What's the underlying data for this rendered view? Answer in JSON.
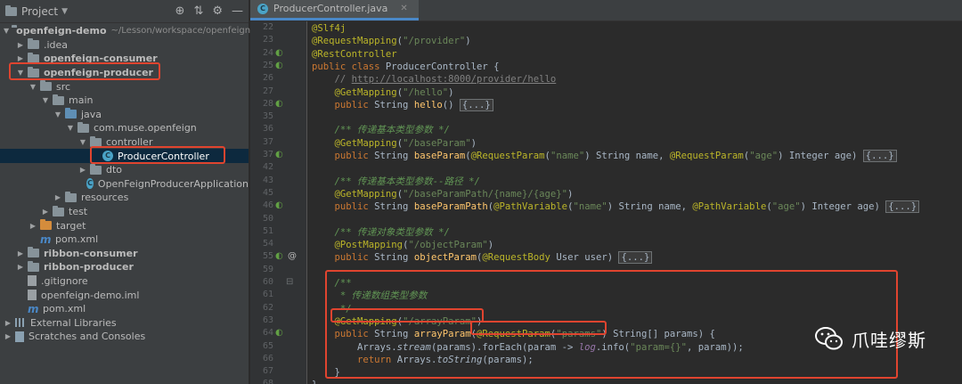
{
  "project_panel": {
    "title": "Project",
    "tree": [
      {
        "label": "openfeign-demo",
        "path": "~/Lesson/workspace/openfeign-d",
        "bold": true,
        "indent": 0,
        "arrow": "down",
        "icon": "folder"
      },
      {
        "label": ".idea",
        "indent": 1,
        "arrow": "right",
        "icon": "folder"
      },
      {
        "label": "openfeign-consumer",
        "bold": true,
        "indent": 1,
        "arrow": "right",
        "icon": "folder"
      },
      {
        "label": "openfeign-producer",
        "bold": true,
        "indent": 1,
        "arrow": "down",
        "icon": "folder"
      },
      {
        "label": "src",
        "indent": 2,
        "arrow": "down",
        "icon": "folder"
      },
      {
        "label": "main",
        "indent": 3,
        "arrow": "down",
        "icon": "folder"
      },
      {
        "label": "java",
        "indent": 4,
        "arrow": "down",
        "icon": "folder-blue"
      },
      {
        "label": "com.muse.openfeign",
        "indent": 5,
        "arrow": "down",
        "icon": "package"
      },
      {
        "label": "controller",
        "indent": 6,
        "arrow": "down",
        "icon": "package"
      },
      {
        "label": "ProducerController",
        "indent": 7,
        "arrow": "",
        "icon": "class",
        "selected": true
      },
      {
        "label": "dto",
        "indent": 6,
        "arrow": "right",
        "icon": "package"
      },
      {
        "label": "OpenFeignProducerApplication",
        "indent": 6,
        "arrow": "",
        "icon": "class"
      },
      {
        "label": "resources",
        "indent": 4,
        "arrow": "right",
        "icon": "folder"
      },
      {
        "label": "test",
        "indent": 3,
        "arrow": "right",
        "icon": "folder"
      },
      {
        "label": "target",
        "indent": 2,
        "arrow": "right",
        "icon": "folder-orange"
      },
      {
        "label": "pom.xml",
        "indent": 2,
        "arrow": "",
        "icon": "maven"
      },
      {
        "label": "ribbon-consumer",
        "bold": true,
        "indent": 1,
        "arrow": "right",
        "icon": "folder"
      },
      {
        "label": "ribbon-producer",
        "bold": true,
        "indent": 1,
        "arrow": "right",
        "icon": "folder"
      },
      {
        "label": ".gitignore",
        "indent": 1,
        "arrow": "",
        "icon": "file"
      },
      {
        "label": "openfeign-demo.iml",
        "indent": 1,
        "arrow": "",
        "icon": "file"
      },
      {
        "label": "pom.xml",
        "indent": 1,
        "arrow": "",
        "icon": "maven"
      },
      {
        "label": "External Libraries",
        "indent": 0,
        "arrow": "right",
        "icon": "library"
      },
      {
        "label": "Scratches and Consoles",
        "indent": 0,
        "arrow": "right",
        "icon": "scratches"
      }
    ]
  },
  "editor": {
    "tab_label": "ProducerController.java",
    "lines": [
      {
        "n": "22",
        "g": "",
        "html": "<span class='an'>@Slf4j</span>"
      },
      {
        "n": "23",
        "g": "",
        "html": "<span class='an'>@RequestMapping</span>(<span class='st'>\"/provider\"</span>)"
      },
      {
        "n": "24",
        "g": "bean",
        "html": "<span class='an'>@RestController</span>"
      },
      {
        "n": "25",
        "g": "bean",
        "html": "<span class='kw'>public class </span>ProducerController {"
      },
      {
        "n": "26",
        "g": "",
        "html": "    <span class='cm'>// </span><span class='lnk'>http://localhost:8000/provider/hello</span>"
      },
      {
        "n": "27",
        "g": "",
        "html": "    <span class='an'>@GetMapping</span>(<span class='st'>\"/hello\"</span>)"
      },
      {
        "n": "28",
        "g": "bean",
        "html": "    <span class='kw'>public </span>String <span class='mth'>hello</span>() <span class='fold-box'>{...}</span>"
      },
      {
        "n": "35",
        "g": "",
        "html": ""
      },
      {
        "n": "36",
        "g": "",
        "html": "    <span class='dc'>/** 传递基本类型参数 */</span>"
      },
      {
        "n": "37",
        "g": "",
        "html": "    <span class='an'>@GetMapping</span>(<span class='st'>\"/baseParam\"</span>)"
      },
      {
        "n": "37",
        "g": "bean",
        "html": "    <span class='kw'>public </span>String <span class='mth'>baseParam</span>(<span class='an'>@RequestParam</span>(<span class='st'>\"name\"</span>) String name, <span class='an'>@RequestParam</span>(<span class='st'>\"age\"</span>) Integer age) <span class='fold-box'>{...}</span>"
      },
      {
        "n": "42",
        "g": "",
        "html": ""
      },
      {
        "n": "43",
        "g": "",
        "html": "    <span class='dc'>/** 传递基本类型参数--路径 */</span>"
      },
      {
        "n": "45",
        "g": "",
        "html": "    <span class='an'>@GetMapping</span>(<span class='st'>\"/baseParamPath/{name}/{age}\"</span>)"
      },
      {
        "n": "46",
        "g": "bean",
        "html": "    <span class='kw'>public </span>String <span class='mth'>baseParamPath</span>(<span class='an'>@PathVariable</span>(<span class='st'>\"name\"</span>) String name, <span class='an'>@PathVariable</span>(<span class='st'>\"age\"</span>) Integer age) <span class='fold-box'>{...}</span>"
      },
      {
        "n": "50",
        "g": "",
        "html": ""
      },
      {
        "n": "51",
        "g": "",
        "html": "    <span class='dc'>/** 传递对象类型参数 */</span>"
      },
      {
        "n": "54",
        "g": "",
        "html": "    <span class='an'>@PostMapping</span>(<span class='st'>\"/objectParam\"</span>)"
      },
      {
        "n": "55",
        "g": "bean-at",
        "html": "    <span class='kw'>public </span>String <span class='mth'>objectParam</span>(<span class='an'>@RequestBody</span> User user) <span class='fold-box'>{...}</span>"
      },
      {
        "n": "59",
        "g": "",
        "html": ""
      },
      {
        "n": "60",
        "g": "fold",
        "html": "    <span class='dc'>/**</span>"
      },
      {
        "n": "61",
        "g": "",
        "html": "<span class='dc'>     * 传递数组类型参数</span>"
      },
      {
        "n": "62",
        "g": "",
        "html": "<span class='dc'>     */</span>"
      },
      {
        "n": "63",
        "g": "",
        "html": "    <span class='an'>@GetMapping</span>(<span class='st'>\"/arrayParam\"</span>)"
      },
      {
        "n": "64",
        "g": "bean",
        "html": "    <span class='kw'>public </span>String <span class='mth'>arrayParam</span>(<span class='an'>@RequestParam</span>(<span class='st'>\"params\"</span>) String[] params) {"
      },
      {
        "n": "65",
        "g": "",
        "html": "        Arrays.<span class='ital'>stream</span>(params).forEach(param -> <span class='fld'>log</span>.info(<span class='st'>\"param={}\"</span>, param));"
      },
      {
        "n": "66",
        "g": "",
        "html": "        <span class='kw'>return </span>Arrays.<span class='ital'>toString</span>(params);"
      },
      {
        "n": "67",
        "g": "",
        "html": "    }"
      },
      {
        "n": "68",
        "g": "",
        "html": "}"
      }
    ]
  },
  "watermark": {
    "text": "爪哇缪斯",
    "icon": "wechat-icon"
  },
  "colors": {
    "highlight_box": "#e0442f",
    "selection": "#0d293e",
    "tab_underline": "#4a88c7"
  }
}
